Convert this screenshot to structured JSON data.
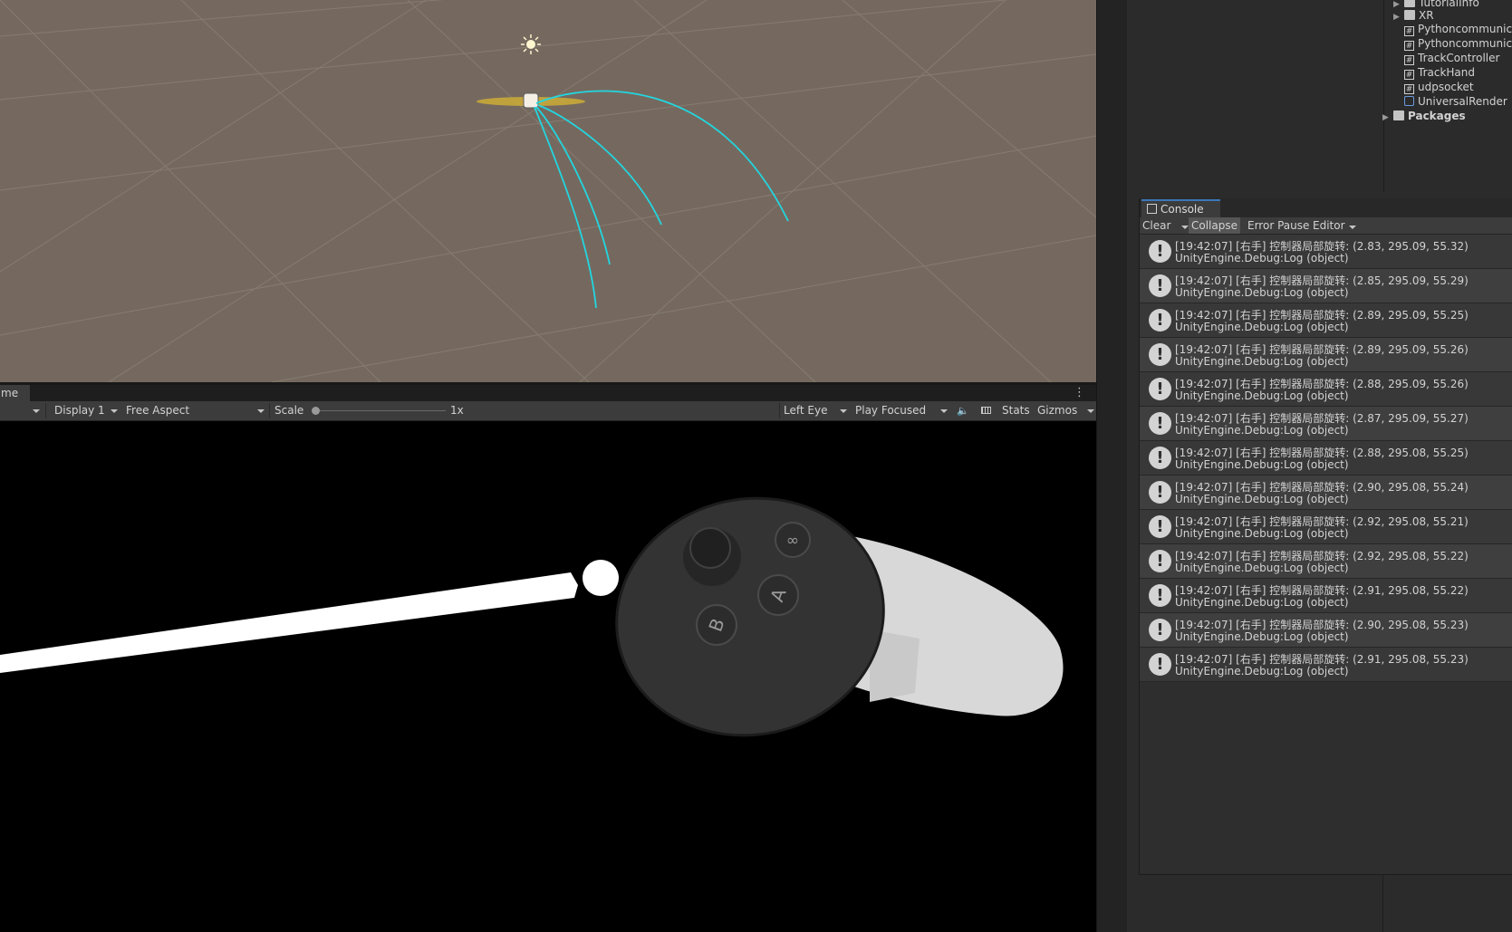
{
  "game": {
    "tab_label": "me",
    "kebab": "⋮",
    "display": "Display 1",
    "aspect": "Free Aspect",
    "scale_label": "Scale",
    "scale_value": "1x",
    "eye": "Left Eye",
    "play_mode": "Play Focused",
    "stats": "Stats",
    "gizmos": "Gizmos",
    "controller_buttons": {
      "a": "A",
      "b": "B",
      "menu": "∞"
    }
  },
  "project": {
    "items": [
      {
        "label": "TutorialInfo",
        "type": "folder",
        "arrow": "▶"
      },
      {
        "label": "XR",
        "type": "folder",
        "arrow": "▶"
      },
      {
        "label": "Pythoncommunic",
        "type": "script"
      },
      {
        "label": "Pythoncommunic",
        "type": "script"
      },
      {
        "label": "TrackController",
        "type": "script"
      },
      {
        "label": "TrackHand",
        "type": "script"
      },
      {
        "label": "udpsocket",
        "type": "script"
      },
      {
        "label": "UniversalRender",
        "type": "asset"
      },
      {
        "label": "Packages",
        "type": "folder",
        "arrow": "▶"
      }
    ]
  },
  "console": {
    "title": "Console",
    "toolbar": {
      "clear": "Clear",
      "collapse": "Collapse",
      "error_pause": "Error Pause",
      "editor": "Editor"
    },
    "entries": [
      {
        "message": "[19:42:07] [右手] 控制器局部旋转: (2.83, 295.09, 55.32)",
        "source": "UnityEngine.Debug:Log (object)"
      },
      {
        "message": "[19:42:07] [右手] 控制器局部旋转: (2.85, 295.09, 55.29)",
        "source": "UnityEngine.Debug:Log (object)"
      },
      {
        "message": "[19:42:07] [右手] 控制器局部旋转: (2.89, 295.09, 55.25)",
        "source": "UnityEngine.Debug:Log (object)"
      },
      {
        "message": "[19:42:07] [右手] 控制器局部旋转: (2.89, 295.09, 55.26)",
        "source": "UnityEngine.Debug:Log (object)"
      },
      {
        "message": "[19:42:07] [右手] 控制器局部旋转: (2.88, 295.09, 55.26)",
        "source": "UnityEngine.Debug:Log (object)"
      },
      {
        "message": "[19:42:07] [右手] 控制器局部旋转: (2.87, 295.09, 55.27)",
        "source": "UnityEngine.Debug:Log (object)"
      },
      {
        "message": "[19:42:07] [右手] 控制器局部旋转: (2.88, 295.08, 55.25)",
        "source": "UnityEngine.Debug:Log (object)"
      },
      {
        "message": "[19:42:07] [右手] 控制器局部旋转: (2.90, 295.08, 55.24)",
        "source": "UnityEngine.Debug:Log (object)"
      },
      {
        "message": "[19:42:07] [右手] 控制器局部旋转: (2.92, 295.08, 55.21)",
        "source": "UnityEngine.Debug:Log (object)"
      },
      {
        "message": "[19:42:07] [右手] 控制器局部旋转: (2.92, 295.08, 55.22)",
        "source": "UnityEngine.Debug:Log (object)"
      },
      {
        "message": "[19:42:07] [右手] 控制器局部旋转: (2.91, 295.08, 55.22)",
        "source": "UnityEngine.Debug:Log (object)"
      },
      {
        "message": "[19:42:07] [右手] 控制器局部旋转: (2.90, 295.08, 55.23)",
        "source": "UnityEngine.Debug:Log (object)"
      },
      {
        "message": "[19:42:07] [右手] 控制器局部旋转: (2.91, 295.08, 55.23)",
        "source": "UnityEngine.Debug:Log (object)"
      }
    ]
  },
  "colors": {
    "scene_bg": "#75695f",
    "ray": "#22d6e0",
    "console_accent": "#3a79bb"
  }
}
